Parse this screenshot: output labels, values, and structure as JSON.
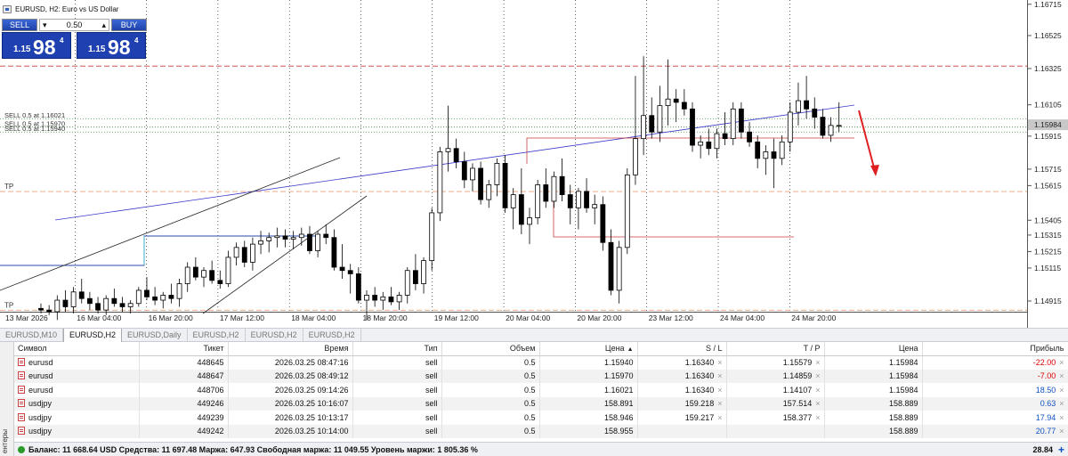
{
  "window": {
    "title": "EURUSD, H2:  Euro vs US Dollar"
  },
  "trade_panel": {
    "sell_label": "SELL",
    "buy_label": "BUY",
    "lot": "0.50",
    "sell_price_small": "1.15",
    "sell_price_big": "98",
    "sell_price_sup": "4",
    "buy_price_small": "1.15",
    "buy_price_big": "98",
    "buy_price_sup": "4"
  },
  "chart_data": {
    "type": "candlestick",
    "y_range": [
      1.1485,
      1.1673
    ],
    "price_ticks": [
      "1.16715",
      "1.16525",
      "1.16325",
      "1.16105",
      "1.15915",
      "1.15715",
      "1.15615",
      "1.15405",
      "1.15315",
      "1.15215",
      "1.15115",
      "1.14915"
    ],
    "time_labels": [
      "13 Mar 2026",
      "16 Mar 04:00",
      "16 Mar 20:00",
      "17 Mar 12:00",
      "18 Mar 04:00",
      "18 Mar 20:00",
      "19 Mar 12:00",
      "20 Mar 04:00",
      "20 Mar 20:00",
      "23 Mar 12:00",
      "24 Mar 04:00",
      "24 Mar 20:00"
    ],
    "current_price_tag": "1.15984",
    "order_lines": [
      {
        "label": "SELL 0.5 at 1.16021",
        "price": 1.16021
      },
      {
        "label": "SELL 0.5 at 1.15970",
        "price": 1.1597
      },
      {
        "label": "SELL 0.5 at 1.15940",
        "price": 1.1594
      }
    ],
    "tp_lines": [
      {
        "label": "TP",
        "price": 1.15579
      },
      {
        "label": "TP",
        "price": 1.14859
      }
    ],
    "sl_line_price": 1.1634,
    "candles": [
      [
        1.1487,
        1.149,
        1.1484,
        1.1486
      ],
      [
        1.1486,
        1.1489,
        1.1483,
        1.1485
      ],
      [
        1.1485,
        1.1495,
        1.148,
        1.1492
      ],
      [
        1.1492,
        1.1498,
        1.1485,
        1.1488
      ],
      [
        1.1488,
        1.15,
        1.1484,
        1.1497
      ],
      [
        1.1497,
        1.1505,
        1.149,
        1.1493
      ],
      [
        1.1493,
        1.1497,
        1.1486,
        1.149
      ],
      [
        1.149,
        1.1494,
        1.1484,
        1.1486
      ],
      [
        1.1486,
        1.1495,
        1.1483,
        1.1493
      ],
      [
        1.1493,
        1.1499,
        1.1488,
        1.149
      ],
      [
        1.149,
        1.1494,
        1.1485,
        1.1488
      ],
      [
        1.1488,
        1.1492,
        1.1484,
        1.149
      ],
      [
        1.149,
        1.15,
        1.1488,
        1.1498
      ],
      [
        1.1498,
        1.1506,
        1.1492,
        1.1494
      ],
      [
        1.1494,
        1.15,
        1.1489,
        1.1492
      ],
      [
        1.1492,
        1.1497,
        1.1487,
        1.1495
      ],
      [
        1.1495,
        1.1502,
        1.149,
        1.1493
      ],
      [
        1.1493,
        1.1505,
        1.1488,
        1.1502
      ],
      [
        1.1502,
        1.1515,
        1.1497,
        1.1512
      ],
      [
        1.1512,
        1.1518,
        1.1504,
        1.1506
      ],
      [
        1.1506,
        1.1512,
        1.15,
        1.151
      ],
      [
        1.151,
        1.1516,
        1.1502,
        1.1504
      ],
      [
        1.1504,
        1.151,
        1.1499,
        1.1502
      ],
      [
        1.1502,
        1.1522,
        1.15,
        1.1518
      ],
      [
        1.1518,
        1.1527,
        1.1513,
        1.1524
      ],
      [
        1.1524,
        1.1528,
        1.1512,
        1.1515
      ],
      [
        1.1515,
        1.153,
        1.151,
        1.1526
      ],
      [
        1.1526,
        1.1534,
        1.152,
        1.1528
      ],
      [
        1.1528,
        1.1533,
        1.1521,
        1.153
      ],
      [
        1.153,
        1.1536,
        1.1524,
        1.1531
      ],
      [
        1.1531,
        1.1535,
        1.1524,
        1.1529
      ],
      [
        1.1529,
        1.1534,
        1.1523,
        1.153
      ],
      [
        1.153,
        1.1536,
        1.1525,
        1.1532
      ],
      [
        1.1532,
        1.1537,
        1.152,
        1.1522
      ],
      [
        1.1522,
        1.1534,
        1.1518,
        1.1532
      ],
      [
        1.1532,
        1.1538,
        1.1526,
        1.153
      ],
      [
        1.153,
        1.1535,
        1.151,
        1.1512
      ],
      [
        1.1512,
        1.1526,
        1.1505,
        1.151
      ],
      [
        1.151,
        1.1514,
        1.1496,
        1.1508
      ],
      [
        1.1508,
        1.1512,
        1.149,
        1.1492
      ],
      [
        1.1492,
        1.1498,
        1.148,
        1.1495
      ],
      [
        1.1495,
        1.15,
        1.1488,
        1.1492
      ],
      [
        1.1492,
        1.1497,
        1.1486,
        1.1494
      ],
      [
        1.1494,
        1.15,
        1.1489,
        1.1491
      ],
      [
        1.1491,
        1.1497,
        1.1486,
        1.1495
      ],
      [
        1.1495,
        1.1512,
        1.149,
        1.151
      ],
      [
        1.151,
        1.152,
        1.1498,
        1.1502
      ],
      [
        1.1502,
        1.1518,
        1.1496,
        1.1516
      ],
      [
        1.1516,
        1.1548,
        1.151,
        1.1545
      ],
      [
        1.1545,
        1.1585,
        1.154,
        1.1582
      ],
      [
        1.1582,
        1.161,
        1.157,
        1.1584
      ],
      [
        1.1584,
        1.159,
        1.1572,
        1.1576
      ],
      [
        1.1576,
        1.1582,
        1.156,
        1.1565
      ],
      [
        1.1565,
        1.1575,
        1.1558,
        1.1572
      ],
      [
        1.1572,
        1.1576,
        1.155,
        1.1553
      ],
      [
        1.1553,
        1.1565,
        1.1548,
        1.1562
      ],
      [
        1.1562,
        1.1578,
        1.1555,
        1.1575
      ],
      [
        1.1575,
        1.158,
        1.1545,
        1.1548
      ],
      [
        1.1548,
        1.156,
        1.1535,
        1.1556
      ],
      [
        1.1556,
        1.1572,
        1.1532,
        1.1538
      ],
      [
        1.1538,
        1.1548,
        1.1526,
        1.1542
      ],
      [
        1.1542,
        1.1565,
        1.1538,
        1.1562
      ],
      [
        1.1562,
        1.1572,
        1.1548,
        1.1552
      ],
      [
        1.1552,
        1.157,
        1.1548,
        1.1567
      ],
      [
        1.1567,
        1.1578,
        1.1552,
        1.1556
      ],
      [
        1.1556,
        1.1562,
        1.1538,
        1.1548
      ],
      [
        1.1548,
        1.156,
        1.1535,
        1.1558
      ],
      [
        1.1558,
        1.1566,
        1.1545,
        1.1548
      ],
      [
        1.1548,
        1.1556,
        1.1538,
        1.155
      ],
      [
        1.155,
        1.1555,
        1.1522,
        1.1527
      ],
      [
        1.1527,
        1.1535,
        1.1495,
        1.1498
      ],
      [
        1.1498,
        1.1528,
        1.149,
        1.1524
      ],
      [
        1.1524,
        1.1572,
        1.152,
        1.1568
      ],
      [
        1.1568,
        1.1628,
        1.1562,
        1.159
      ],
      [
        1.159,
        1.164,
        1.158,
        1.1604
      ],
      [
        1.1604,
        1.1615,
        1.159,
        1.1594
      ],
      [
        1.1594,
        1.1622,
        1.1588,
        1.161
      ],
      [
        1.161,
        1.1638,
        1.1598,
        1.1614
      ],
      [
        1.1614,
        1.162,
        1.16,
        1.1612
      ],
      [
        1.1612,
        1.162,
        1.1604,
        1.1608
      ],
      [
        1.1608,
        1.1612,
        1.1582,
        1.1586
      ],
      [
        1.1586,
        1.1592,
        1.1578,
        1.1588
      ],
      [
        1.1588,
        1.1596,
        1.158,
        1.1584
      ],
      [
        1.1584,
        1.1596,
        1.1578,
        1.1593
      ],
      [
        1.1593,
        1.1606,
        1.1586,
        1.159
      ],
      [
        1.159,
        1.1612,
        1.1586,
        1.1608
      ],
      [
        1.1608,
        1.1612,
        1.159,
        1.1594
      ],
      [
        1.1594,
        1.16,
        1.1585,
        1.1588
      ],
      [
        1.1588,
        1.1592,
        1.1572,
        1.1578
      ],
      [
        1.1578,
        1.1586,
        1.1568,
        1.1582
      ],
      [
        1.1582,
        1.159,
        1.156,
        1.1578
      ],
      [
        1.1578,
        1.1592,
        1.1574,
        1.1588
      ],
      [
        1.1588,
        1.1612,
        1.1582,
        1.1606
      ],
      [
        1.1606,
        1.1624,
        1.1598,
        1.1613
      ],
      [
        1.1613,
        1.1628,
        1.1602,
        1.1608
      ],
      [
        1.1608,
        1.1615,
        1.1596,
        1.1603
      ],
      [
        1.1603,
        1.1608,
        1.159,
        1.1592
      ],
      [
        1.1592,
        1.1603,
        1.1588,
        1.1598
      ],
      [
        1.1598,
        1.1612,
        1.1594,
        1.1598
      ]
    ]
  },
  "tabs": [
    "EURUSD,M10",
    "EURUSD,H2",
    "EURUSD,Daily",
    "EURUSD,H2",
    "EURUSD,H2",
    "EURUSD,H2"
  ],
  "active_tab": 1,
  "table": {
    "columns": [
      "Символ",
      "Тикет",
      "Время",
      "Тип",
      "Объем",
      "Цена",
      "S / L",
      "T / P",
      "Цена",
      "Прибыль"
    ],
    "rows": [
      [
        "eurusd",
        "448645",
        "2026.03.25 08:47:16",
        "sell",
        "0.5",
        "1.15940",
        "1.16340",
        "1.15579",
        "1.15984",
        "-22.00"
      ],
      [
        "eurusd",
        "448647",
        "2026.03.25 08:49:12",
        "sell",
        "0.5",
        "1.15970",
        "1.16340",
        "1.14859",
        "1.15984",
        "-7.00"
      ],
      [
        "eurusd",
        "448706",
        "2026.03.25 09:14:26",
        "sell",
        "0.5",
        "1.16021",
        "1.16340",
        "1.14107",
        "1.15984",
        "18.50"
      ],
      [
        "usdjpy",
        "449246",
        "2026.03.25 10:16:07",
        "sell",
        "0.5",
        "158.891",
        "159.218",
        "157.514",
        "158.889",
        "0.63"
      ],
      [
        "usdjpy",
        "449239",
        "2026.03.25 10:13:17",
        "sell",
        "0.5",
        "158.946",
        "159.217",
        "158.377",
        "158.889",
        "17.94"
      ],
      [
        "usdjpy",
        "449242",
        "2026.03.25 10:14:00",
        "sell",
        "0.5",
        "158.955",
        "",
        "",
        "158.889",
        "20.77"
      ]
    ]
  },
  "status": {
    "text": "Баланс: 11 668.64 USD  Средства: 11 697.48  Маржа: 647.93  Свободная маржа: 11 049.55  Уровень маржи: 1 805.36 %",
    "total": "28.84"
  },
  "side_label": "ентеры",
  "colors": {
    "candle": "#000000",
    "trend_blue": "#3c3cc8",
    "sl": "#c83c3c",
    "tp": "#e8a07a",
    "orders": "#3c8a3c",
    "arrow": "#e02020"
  }
}
